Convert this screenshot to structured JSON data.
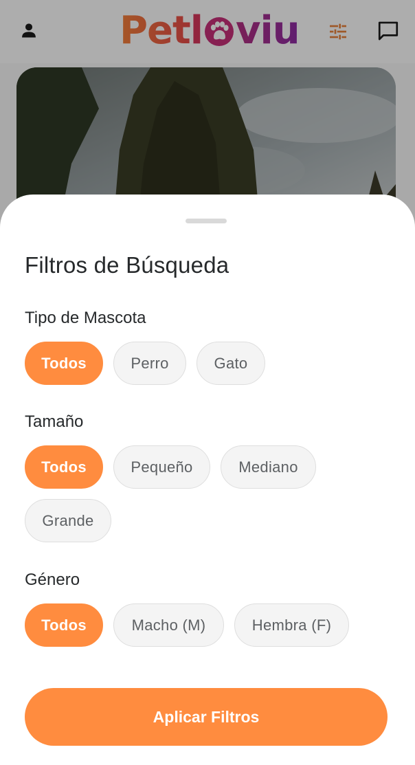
{
  "header": {
    "logo_text": "Petloviu",
    "logo_parts": [
      "Pet",
      "l",
      "viu"
    ],
    "icons": {
      "profile": "person-icon",
      "filters": "sliders-icon",
      "chat": "chat-bubble-icon"
    },
    "colors": {
      "accent": "#FF8C3F",
      "logo_start": "#F5823A",
      "logo_end": "#8E2DA6"
    }
  },
  "hero": {
    "alt": "pet photo"
  },
  "filters_sheet": {
    "title": "Filtros de Búsqueda",
    "sections": [
      {
        "label": "Tipo de Mascota",
        "options": [
          {
            "label": "Todos",
            "selected": true
          },
          {
            "label": "Perro",
            "selected": false
          },
          {
            "label": "Gato",
            "selected": false
          }
        ]
      },
      {
        "label": "Tamaño",
        "options": [
          {
            "label": "Todos",
            "selected": true
          },
          {
            "label": "Pequeño",
            "selected": false
          },
          {
            "label": "Mediano",
            "selected": false
          },
          {
            "label": "Grande",
            "selected": false
          }
        ]
      },
      {
        "label": "Género",
        "options": [
          {
            "label": "Todos",
            "selected": true
          },
          {
            "label": "Macho (M)",
            "selected": false
          },
          {
            "label": "Hembra (F)",
            "selected": false
          }
        ]
      }
    ],
    "apply_label": "Aplicar Filtros"
  }
}
